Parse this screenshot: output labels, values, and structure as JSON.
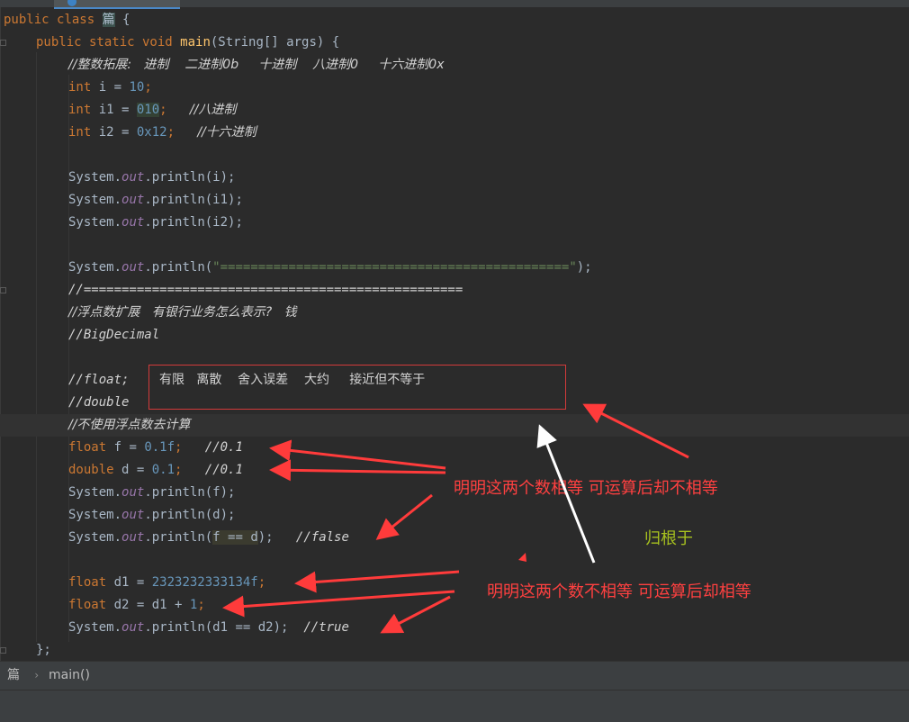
{
  "editor": {
    "colors": {
      "keyword": "#cc7832",
      "number": "#6897bb",
      "field": "#9876aa",
      "method": "#ffc66d",
      "string": "#6a8759",
      "text": "#a9b7c6",
      "comment": "#d2d2d2",
      "annotation_red": "#ff4040",
      "annotation_green": "#a7c11f"
    },
    "code": {
      "l1": {
        "kw1": "public",
        "kw2": "class",
        "cls": "篇",
        "rest": " {"
      },
      "l2": {
        "kw": "public static void",
        "fn": "main",
        "rest": "(String[] args) {"
      },
      "l3": {
        "text": "//整数拓展:   进制    二进制0b     十进制    八进制0     十六进制0x"
      },
      "l4": {
        "kw": "int",
        "mid": " i = ",
        "num": "10",
        "end": ";"
      },
      "l5": {
        "kw": "int",
        "mid": " i1 = ",
        "num": "010",
        "end": ";",
        "cmt": "//八进制"
      },
      "l6": {
        "kw": "int",
        "mid": " i2 = ",
        "num": "0x12",
        "end": ";",
        "cmt": "//十六进制"
      },
      "l8": {
        "pre": "System.",
        "fld": "out",
        "post": ".println(i);"
      },
      "l9": {
        "pre": "System.",
        "fld": "out",
        "post": ".println(i1);"
      },
      "l10": {
        "pre": "System.",
        "fld": "out",
        "post": ".println(i2);"
      },
      "l12": {
        "pre": "System.",
        "fld": "out",
        "post": ".println(",
        "str": "\"==============================================\"",
        "end": ");"
      },
      "l13": {
        "text": "//=================================================="
      },
      "l14": {
        "text": "//浮点数扩展   有银行业务怎么表示?   钱"
      },
      "l15": {
        "text": "//BigDecimal"
      },
      "l17": {
        "text": "//float;"
      },
      "l18": {
        "text": "//double"
      },
      "l19": {
        "text": "//不使用浮点数去计算"
      },
      "l20": {
        "kw": "float",
        "mid": " f = ",
        "num": "0.1f",
        "end": ";",
        "cmt": "//0.1"
      },
      "l21": {
        "kw": "double",
        "mid": " d = ",
        "num": "0.1",
        "end": ";",
        "cmt": "//0.1"
      },
      "l22": {
        "pre": "System.",
        "fld": "out",
        "post": ".println(f);"
      },
      "l23": {
        "pre": "System.",
        "fld": "out",
        "post": ".println(d);"
      },
      "l24": {
        "pre": "System.",
        "fld": "out",
        "mid": ".println(",
        "expr": "f == d",
        "end": ");",
        "cmt": "//false"
      },
      "l26": {
        "kw": "float",
        "mid": " d1 = ",
        "num": "2323232333134f",
        "end": ";"
      },
      "l27": {
        "kw": "float",
        "mid": " d2 = d1 + ",
        "num": "1",
        "end": ";"
      },
      "l28": {
        "pre": "System.",
        "fld": "out",
        "post": ".println(d1 == d2);",
        "cmt": "//true"
      },
      "l29": {
        "text": "};"
      }
    }
  },
  "annotations": {
    "box_text": "有限   离散    舍入误差    大约     接近但不等于",
    "label1": "明明这两个数相等 可运算后却不相等",
    "label2": "明明这两个数不相等  可运算后却相等",
    "label3": "归根于"
  },
  "status_bar": {
    "crumb1": "篇",
    "separator": "›",
    "crumb2": "main()"
  }
}
